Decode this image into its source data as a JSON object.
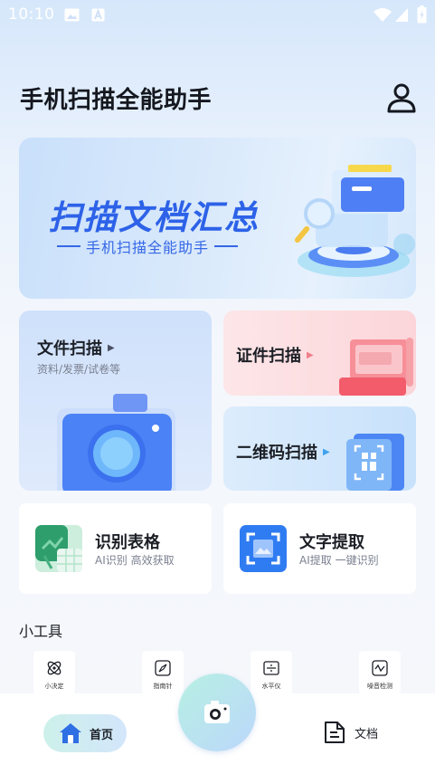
{
  "status": {
    "time": "10:10"
  },
  "header": {
    "title": "手机扫描全能助手"
  },
  "banner": {
    "title": "扫描文档汇总",
    "subtitle": "手机扫描全能助手"
  },
  "cards": {
    "doc_scan": {
      "title": "文件扫描",
      "subtitle": "资料/发票/试卷等"
    },
    "id_scan": {
      "title": "证件扫描"
    },
    "qr_scan": {
      "title": "二维码扫描"
    }
  },
  "features": [
    {
      "title": "识别表格",
      "subtitle": "AI识别 高效获取"
    },
    {
      "title": "文字提取",
      "subtitle": "AI提取 一键识别"
    }
  ],
  "tools": {
    "title": "小工具",
    "items": [
      {
        "label": "小决定",
        "icon": "atom-icon"
      },
      {
        "label": "指南针",
        "icon": "compass-icon"
      },
      {
        "label": "水平仪",
        "icon": "level-icon"
      },
      {
        "label": "噪音检测",
        "icon": "noise-icon"
      }
    ]
  },
  "nav": {
    "home_label": "首页",
    "docs_label": "文档"
  },
  "colors": {
    "accent": "#2d62e8",
    "home_icon": "#2f6fe4"
  }
}
